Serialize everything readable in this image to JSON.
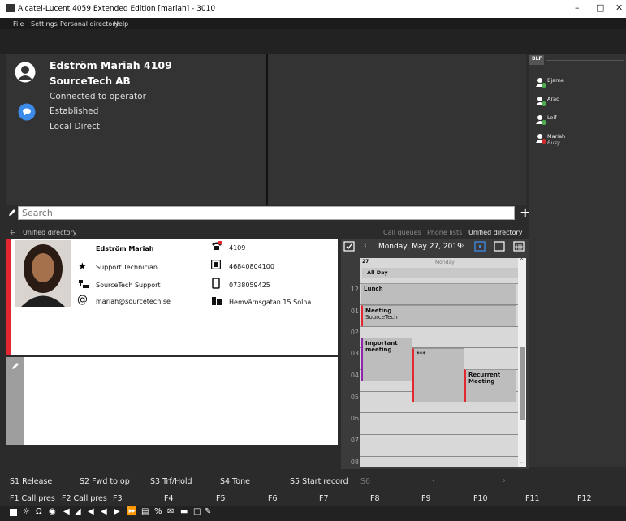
{
  "window": {
    "title": "Alcatel-Lucent 4059 Extended Edition [mariah] - 3010"
  },
  "menu": [
    "File",
    "Settings",
    "Personal directory",
    "Help"
  ],
  "call": {
    "name": "Edström Mariah 4109",
    "company": "SourceTech AB",
    "status1": "Connected to operator",
    "status2": "Established",
    "status3": "Local Direct"
  },
  "blf": {
    "tab": "BLF",
    "items": [
      {
        "name": "Bjarne",
        "status": ""
      },
      {
        "name": "Arad",
        "status": ""
      },
      {
        "name": "Leif",
        "status": ""
      },
      {
        "name": "Mariah",
        "status": "Busy"
      }
    ]
  },
  "search": {
    "placeholder": "Search",
    "add": "+"
  },
  "directory": {
    "left_label": "Unified directory",
    "links": [
      "Call queues",
      "Phone lists",
      "Unified directory"
    ]
  },
  "contact": {
    "name": "Edström Mariah",
    "title": "Support Technician",
    "department": "SourceTech  Support",
    "email": "mariah@sourcetech.se",
    "ext": "4109",
    "phone": "46840804100",
    "mobile": "0738059425",
    "address": "Hemvärnsgatan 15  Solna"
  },
  "calendar": {
    "date": "Monday, May 27, 2019",
    "day_num": "27",
    "day_name": "Monday",
    "all_day": "All Day",
    "hours": [
      "12",
      "01",
      "02",
      "03",
      "04",
      "05",
      "06",
      "07",
      "08"
    ],
    "events": [
      {
        "title": "Lunch",
        "sub": ""
      },
      {
        "title": "Meeting",
        "sub": "SourceTech"
      },
      {
        "title": "Important meeting",
        "sub": ""
      },
      {
        "title": "***",
        "sub": ""
      },
      {
        "title": "Recurrent Meeting",
        "sub": ""
      }
    ]
  },
  "softkeys": [
    "S1 Release",
    "S2 Fwd to op",
    "S3 Trf/Hold",
    "S4 Tone",
    "S5 Start record",
    "S6"
  ],
  "fkeys": [
    "F1 Call pres",
    "F2 Call pres",
    "F3",
    "F4",
    "F5",
    "F6",
    "F7",
    "F8",
    "F9",
    "F10",
    "F11",
    "F12"
  ],
  "colors": {
    "accent_red": "#e3262f",
    "busy": "#d12b2b",
    "free": "#4caf50",
    "blue": "#3d8be8"
  }
}
